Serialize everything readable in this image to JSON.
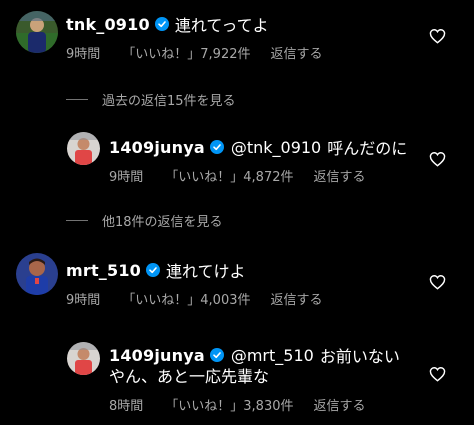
{
  "colors": {
    "background": "#000000",
    "text": "#ffffff",
    "muted": "#a8a8a8",
    "verified": "#0095f6"
  },
  "comments": [
    {
      "username": "tnk_0910",
      "text": "連れてってよ",
      "time": "9時間",
      "likes": "「いいね！」7,922件",
      "reply": "返信する"
    },
    {
      "username": "mrt_510",
      "text": "連れてけよ",
      "time": "9時間",
      "likes": "「いいね！」4,003件",
      "reply": "返信する"
    }
  ],
  "replies": [
    {
      "username": "1409junya",
      "mention": "@tnk_0910",
      "text": "呼んだのに",
      "time": "9時間",
      "likes": "「いいね！」4,872件",
      "reply": "返信する"
    },
    {
      "username": "1409junya",
      "mention": "@mrt_510",
      "text": "お前いない",
      "text_line2": "やん、あと一応先輩な",
      "time": "8時間",
      "likes": "「いいね！」3,830件",
      "reply": "返信する"
    }
  ],
  "view_replies": [
    {
      "label": "過去の返信15件を見る"
    },
    {
      "label": "他18件の返信を見る"
    }
  ],
  "icons": {
    "verified": "verified-badge-icon",
    "like": "heart-icon"
  }
}
